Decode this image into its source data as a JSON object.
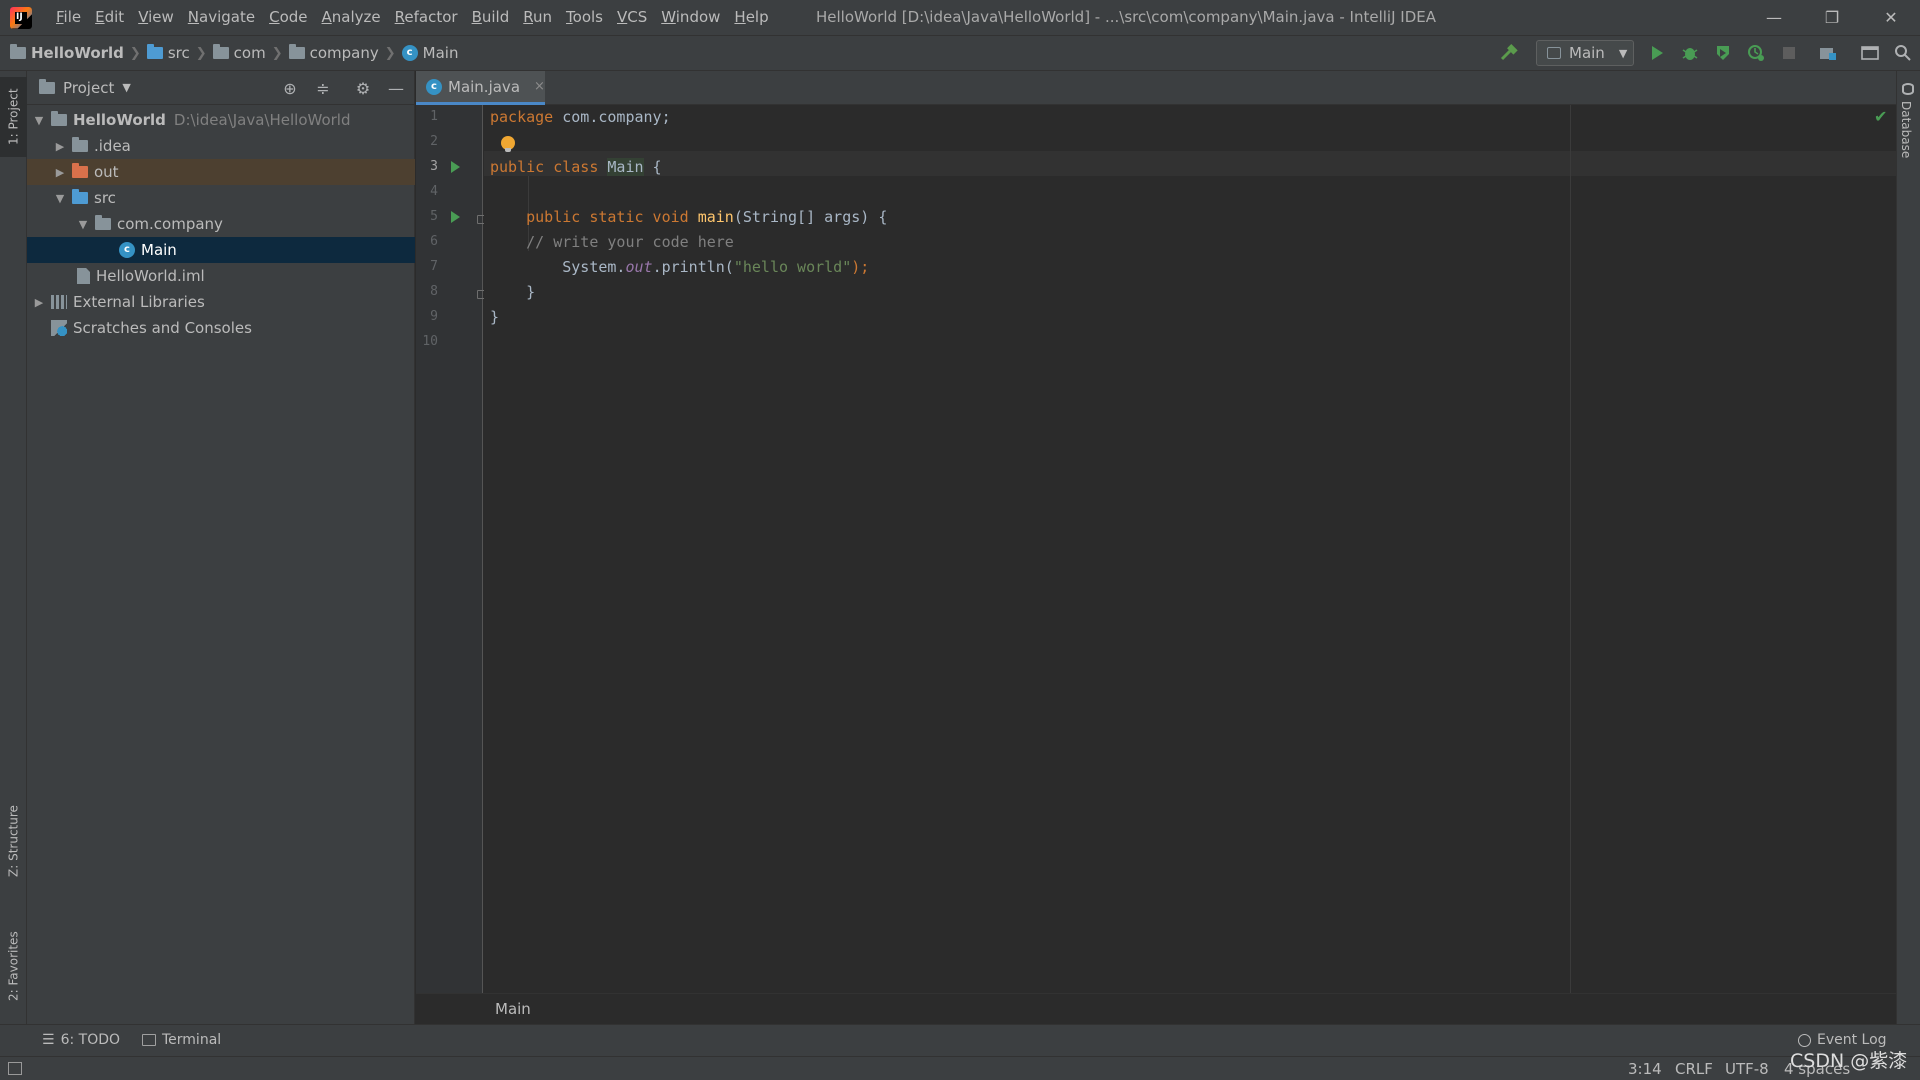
{
  "app": {
    "logo_text": "IJ",
    "window_title": "HelloWorld [D:\\idea\\Java\\HelloWorld] - ...\\src\\com\\company\\Main.java - IntelliJ IDEA"
  },
  "menu": [
    "File",
    "Edit",
    "View",
    "Navigate",
    "Code",
    "Analyze",
    "Refactor",
    "Build",
    "Run",
    "Tools",
    "VCS",
    "Window",
    "Help"
  ],
  "window_controls": {
    "minimize": "—",
    "restore": "❐",
    "close": "✕"
  },
  "breadcrumb": [
    "HelloWorld",
    "src",
    "com",
    "company",
    "Main"
  ],
  "run_config": {
    "label": "Main"
  },
  "left_strip": {
    "project": "1: Project",
    "structure": "Z: Structure",
    "favorites": "2: Favorites"
  },
  "project_panel": {
    "title": "Project",
    "tree": [
      {
        "label": "HelloWorld",
        "hint": "D:\\idea\\Java\\HelloWorld",
        "arrow": "▼",
        "icon": "project-folder"
      },
      {
        "label": ".idea",
        "arrow": "▶",
        "icon": "folder"
      },
      {
        "label": "out",
        "arrow": "▶",
        "icon": "folder-orange"
      },
      {
        "label": "src",
        "arrow": "▼",
        "icon": "folder-blue"
      },
      {
        "label": "com.company",
        "arrow": "▼",
        "icon": "package"
      },
      {
        "label": "Main",
        "icon": "class"
      },
      {
        "label": "HelloWorld.iml",
        "icon": "iml-file"
      },
      {
        "label": "External Libraries",
        "arrow": "▶",
        "icon": "libraries"
      },
      {
        "label": "Scratches and Consoles",
        "icon": "scratches"
      }
    ]
  },
  "editor": {
    "tab": {
      "label": "Main.java",
      "close": "×"
    },
    "line_numbers": [
      "1",
      "2",
      "3",
      "4",
      "5",
      "6",
      "7",
      "8",
      "9",
      "10"
    ],
    "code": {
      "l1_kw": "package",
      "l1_rest": " com.company;",
      "l3_kw": "public class ",
      "l3_cls": "Main",
      "l3_rest": " {",
      "l5_kw": "    public static void ",
      "l5_fn": "main",
      "l5_rest": "(String[] args) {",
      "l6_cm": "    // write your code here",
      "l7_a": "        System.",
      "l7_fld": "out",
      "l7_b": ".println(",
      "l7_st": "\"hello world\"",
      "l7_c": ");",
      "l8": "    }",
      "l9": "}"
    },
    "bottom_breadcrumb": "Main"
  },
  "right_strip": {
    "database": "Database"
  },
  "bottom_bar": {
    "todo": "6: TODO",
    "terminal": "Terminal",
    "event_log": "Event Log"
  },
  "status_bar": {
    "position": "3:14",
    "line_sep": "CRLF",
    "encoding": "UTF-8",
    "indent": "4 spaces"
  },
  "watermark": "CSDN @紫漆"
}
